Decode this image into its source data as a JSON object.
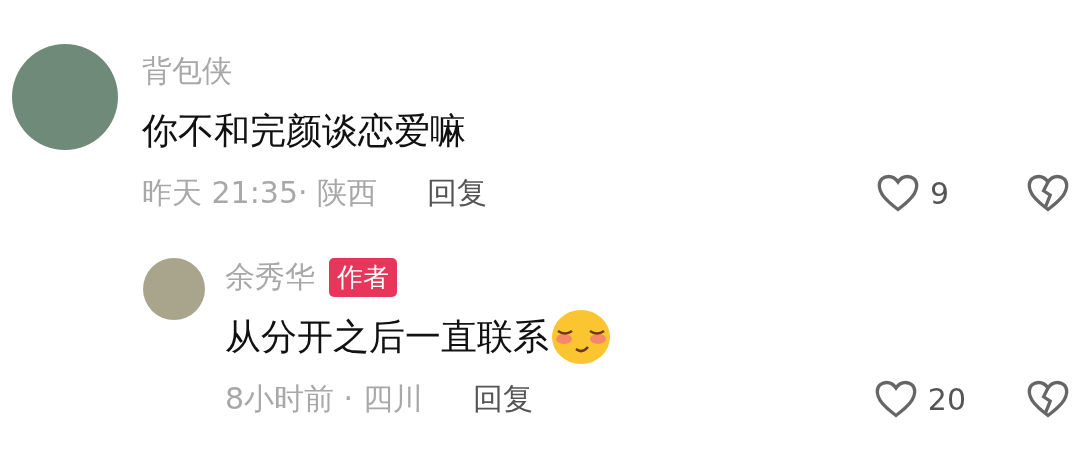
{
  "comments": [
    {
      "author": "背包侠",
      "text": "你不和完颜谈恋爱嘛",
      "time_location": "昨天 21:35· 陕西",
      "reply_label": "回复",
      "likes": "9",
      "emoji": false,
      "children": [
        {
          "author": "余秀华",
          "badge": "作者",
          "text": "从分开之后一直联系",
          "time_location": "8小时前 · 四川",
          "reply_label": "回复",
          "likes": "20",
          "emoji": true
        }
      ]
    }
  ]
}
